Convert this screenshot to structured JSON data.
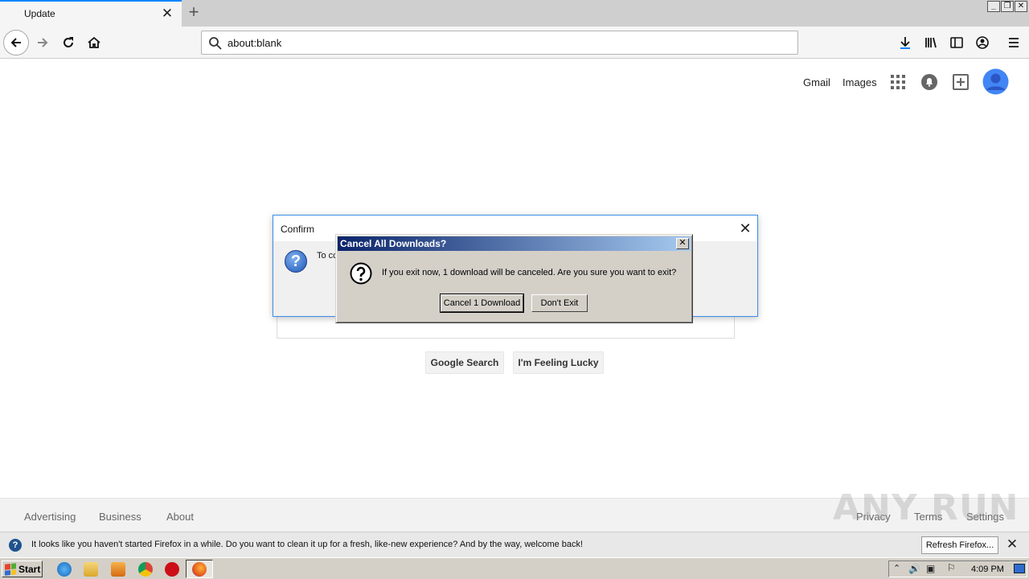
{
  "browser": {
    "tab_title": "Update",
    "url": "about:blank"
  },
  "google": {
    "gmail": "Gmail",
    "images": "Images",
    "search_button": "Google Search",
    "lucky_button": "I'm Feeling Lucky",
    "footer_left": [
      "Advertising",
      "Business",
      "About"
    ],
    "footer_right": [
      "Privacy",
      "Terms",
      "Settings"
    ]
  },
  "watermark": "ANY RUN",
  "confirm_dialog": {
    "title": "Confirm",
    "message": "To cc"
  },
  "downloads_dialog": {
    "title": "Cancel All Downloads?",
    "message": "If you exit now, 1 download will be canceled. Are you sure you want to exit?",
    "cancel_button": "Cancel 1 Download",
    "stay_button": "Don't Exit"
  },
  "notification": {
    "text": "It looks like you haven't started Firefox in a while. Do you want to clean it up for a fresh, like-new experience? And by the way, welcome back!",
    "button": "Refresh Firefox..."
  },
  "taskbar": {
    "start": "Start",
    "clock": "4:09 PM"
  },
  "colors": {
    "accent": "#0a84ff",
    "titlebar_start": "#0a246a",
    "titlebar_end": "#a6caf0",
    "avatar": "#4285f4"
  }
}
